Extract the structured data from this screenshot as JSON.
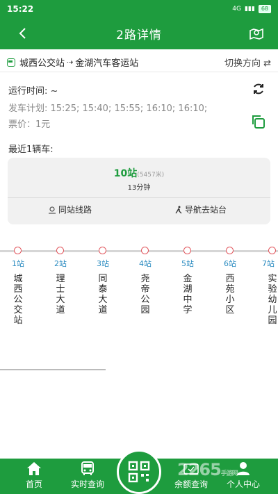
{
  "status": {
    "time": "15:22",
    "battery": "68",
    "net": "4G"
  },
  "appbar": {
    "title": "2路详情"
  },
  "route": {
    "from": "城西公交站",
    "arrow": "⇢",
    "to": "金湖汽车客运站",
    "switch_label": "切换方向 ⇄"
  },
  "info": {
    "run_time": "运行时间: ~",
    "schedule": "发车计划: 15:25; 15:40; 15:55; 16:10; 16:10;",
    "fare": "票价：1元",
    "recent": "最近1辆车:"
  },
  "bus_card": {
    "stations": "10站",
    "distance": "(5457米)",
    "eta": "13分钟",
    "same_station_label": "同站线路",
    "navigate_label": "导航去站台"
  },
  "stops": [
    {
      "num": "1站",
      "name": "城西公交站"
    },
    {
      "num": "2站",
      "name": "理士大道"
    },
    {
      "num": "3站",
      "name": "同泰大道"
    },
    {
      "num": "4站",
      "name": "尧帝公园"
    },
    {
      "num": "5站",
      "name": "金湖中学"
    },
    {
      "num": "6站",
      "name": "西苑小区"
    },
    {
      "num": "7站",
      "name": "实验幼儿园"
    }
  ],
  "tabs": {
    "home": "首页",
    "realtime": "实时查询",
    "balance": "余额查询",
    "profile": "个人中心"
  },
  "watermark": {
    "text": "2265",
    "sub": "手游网"
  },
  "colors": {
    "brand": "#1e9c3e",
    "stop_ring": "#e2575e",
    "stop_num": "#2a8bc0"
  }
}
